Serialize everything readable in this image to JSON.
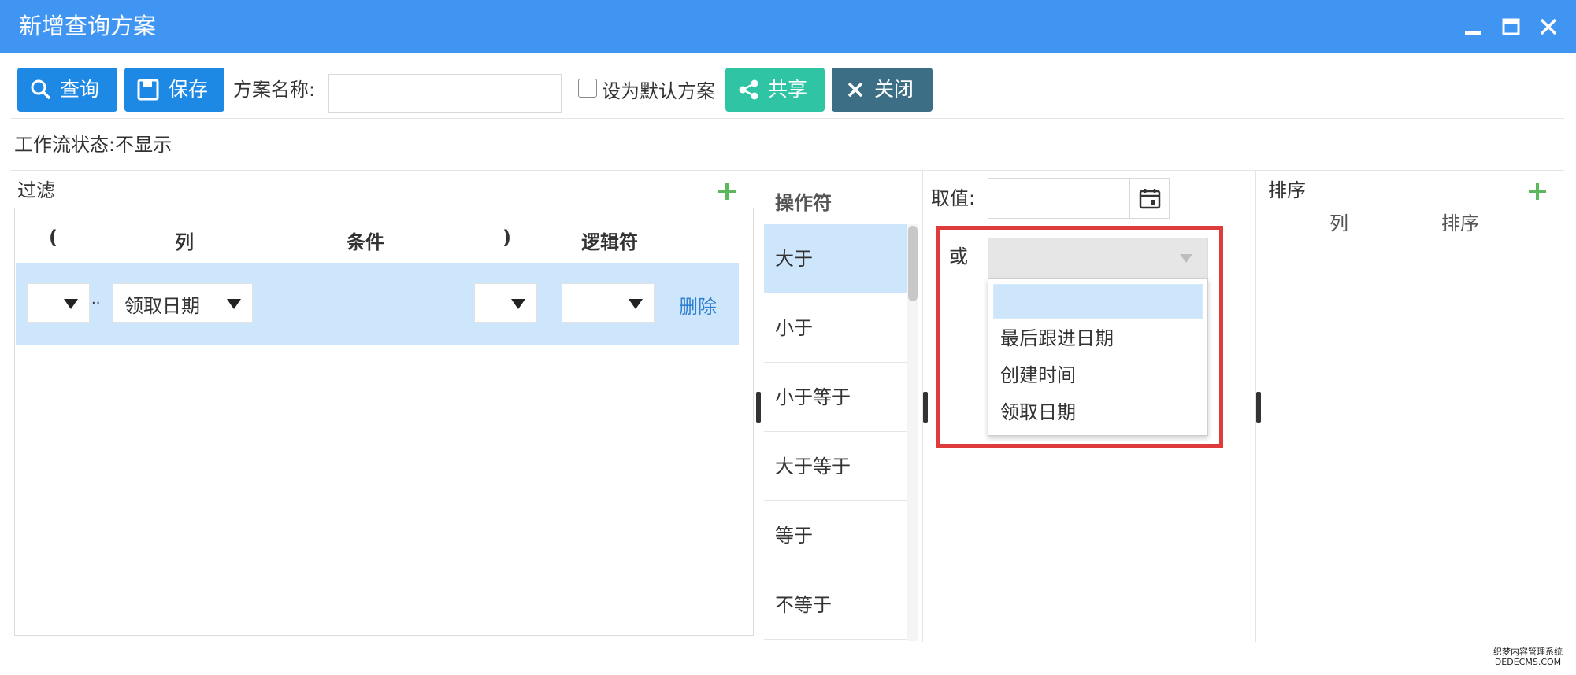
{
  "window": {
    "title": "新增查询方案"
  },
  "toolbar": {
    "query_label": "查询",
    "save_label": "保存",
    "scheme_name_label": "方案名称:",
    "scheme_name_value": "",
    "default_checkbox_label": "设为默认方案",
    "share_label": "共享",
    "close_label": "关闭"
  },
  "workflow": {
    "text": "工作流状态:不显示"
  },
  "filter": {
    "title": "过滤",
    "headers": [
      "(",
      "列",
      "条件",
      ")",
      "逻辑符"
    ],
    "row": {
      "column_value": "领取日期",
      "dots": "..",
      "delete_label": "删除"
    }
  },
  "operators": {
    "header": "操作符",
    "items": [
      "大于",
      "小于",
      "小于等于",
      "大于等于",
      "等于",
      "不等于"
    ],
    "selected_index": 0
  },
  "value": {
    "label": "取值:",
    "or_label": "或",
    "dropdown_options": [
      "",
      "最后跟进日期",
      "创建时间",
      "领取日期"
    ],
    "highlighted_index": 0
  },
  "sort": {
    "title": "排序",
    "headers": [
      "列",
      "排序"
    ]
  },
  "colors": {
    "titlebar": "#3f95f1",
    "primary_button": "#1e88e5",
    "share_button": "#2ec4a4",
    "close_button": "#3c6e85",
    "highlight_row": "#cde6fb",
    "red_outline": "#e03b3b",
    "plus_green": "#5cb85c",
    "link_blue": "#2f7fd0"
  },
  "watermark": "织梦内容管理系统 DEDECMS.COM"
}
